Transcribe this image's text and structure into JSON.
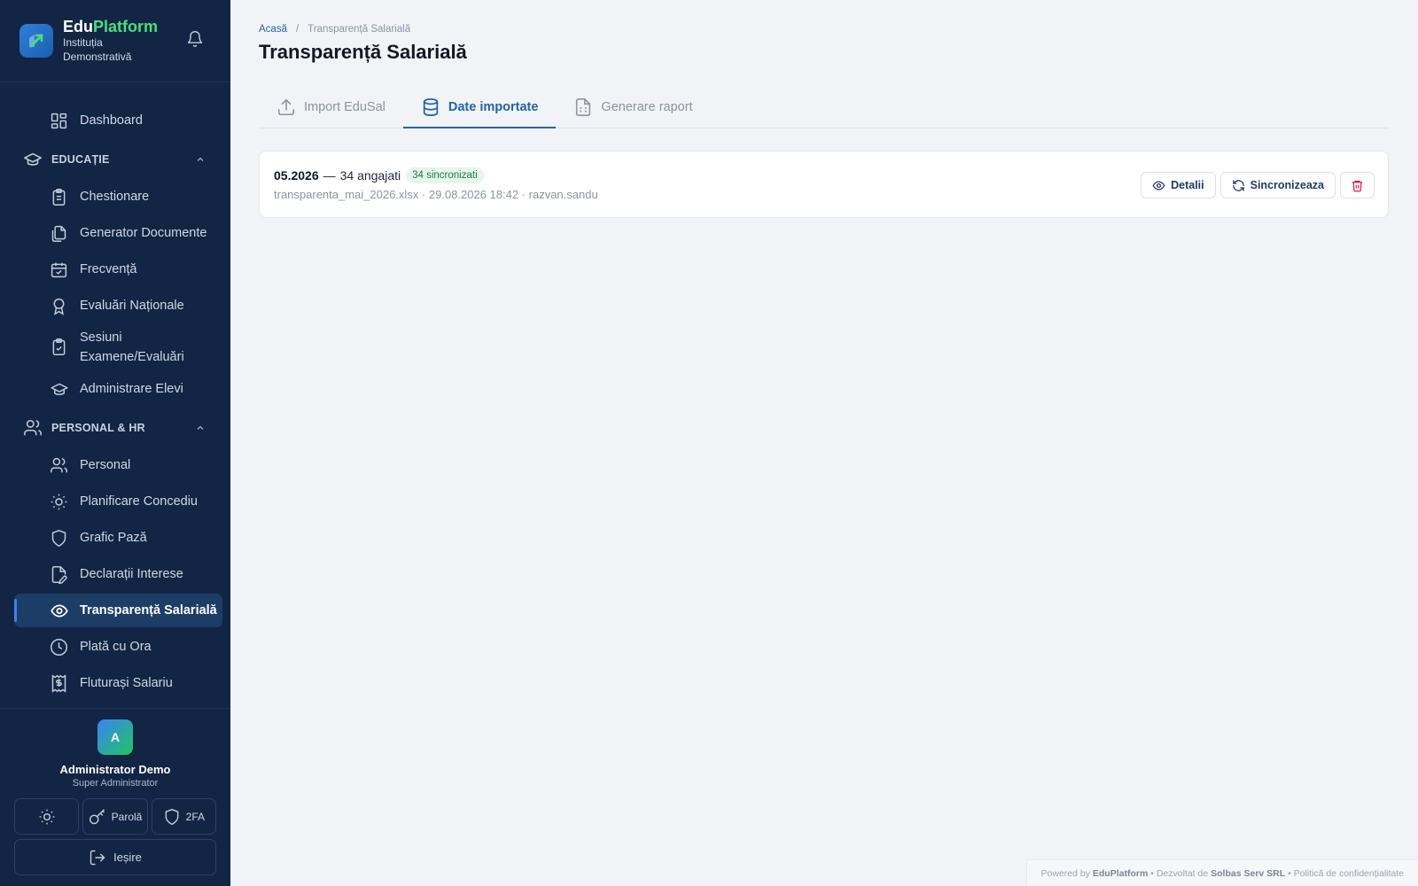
{
  "brand": {
    "name_part1": "Edu",
    "name_part2": "Platform",
    "institution_line1": "Instituția",
    "institution_line2": "Demonstrativă"
  },
  "nav": {
    "dashboard": "Dashboard",
    "section_education": "EDUCAȚIE",
    "education_items": [
      "Chestionare",
      "Generator Documente",
      "Frecvență",
      "Evaluări Naționale"
    ],
    "exam_sessions_line1": "Sesiuni",
    "exam_sessions_line2": "Examene/Evaluări",
    "student_admin": "Administrare Elevi",
    "section_hr": "PERSONAL & HR",
    "hr_items": [
      "Personal",
      "Planificare Concediu",
      "Grafic Pază",
      "Declarații Interese",
      "Transparență Salarială",
      "Plată cu Ora",
      "Fluturași Salariu"
    ]
  },
  "user": {
    "initial": "A",
    "name": "Administrator Demo",
    "role": "Super Administrator",
    "password_label": "Parolă",
    "twofa_label": "2FA",
    "logout_label": "Ieșire"
  },
  "breadcrumb": {
    "home": "Acasă",
    "separator": "/",
    "current": "Transparență Salarială"
  },
  "page_title": "Transparență Salarială",
  "tabs": [
    "Import EduSal",
    "Date importate",
    "Generare raport"
  ],
  "import_record": {
    "period": "05.2026",
    "dash": "—",
    "employees": "34 angajati",
    "synced_badge": "34 sincronizati",
    "meta": "transparenta_mai_2026.xlsx · 29.08.2026 18:42 · razvan.sandu",
    "details_label": "Detalii",
    "sync_label": "Sincronizeaza"
  },
  "footer": {
    "powered": "Powered by",
    "platform": "EduPlatform",
    "dev": "• Dezvoltat de",
    "company": "Solbas Serv SRL",
    "privacy": "• Politică de confidențialitate"
  },
  "colors": {
    "sidebar_bg": "#122544",
    "accent": "#2563a8",
    "brand_green": "#4ade80",
    "badge_green": "#18803f",
    "danger": "#e11d48"
  }
}
